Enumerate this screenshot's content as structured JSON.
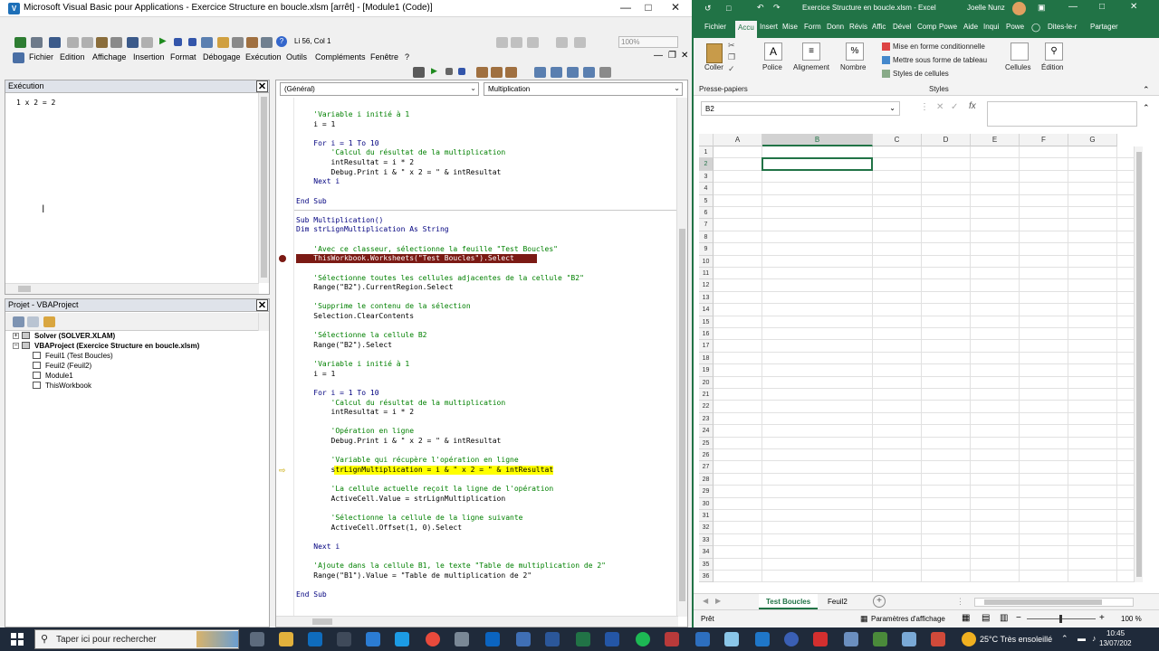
{
  "vba": {
    "title": "Microsoft Visual Basic pour Applications - Exercice Structure en boucle.xlsm [arrêt] - [Module1 (Code)]",
    "position": "Li 56, Col 1",
    "zoom": "100%",
    "menu": [
      "Fichier",
      "Edition",
      "Affichage",
      "Insertion",
      "Format",
      "Débogage",
      "Exécution",
      "Outils",
      "Compléments",
      "Fenêtre",
      "?"
    ],
    "immediate": {
      "title": "Exécution",
      "output": "1 x 2 = 2"
    },
    "project": {
      "title": "Projet - VBAProject",
      "tree": [
        {
          "label": "Solver (SOLVER.XLAM)",
          "bold": true,
          "level": 0
        },
        {
          "label": "VBAProject (Exercice Structure en boucle.xlsm)",
          "bold": true,
          "level": 0
        },
        {
          "label": "Feuil1 (Test Boucles)",
          "bold": false,
          "level": 1
        },
        {
          "label": "Feuil2 (Feuil2)",
          "bold": false,
          "level": 1
        },
        {
          "label": "Module1",
          "bold": false,
          "level": 1
        },
        {
          "label": "ThisWorkbook",
          "bold": false,
          "level": 1
        }
      ]
    },
    "code": {
      "object_combo": "(Général)",
      "proc_combo": "Multiplication",
      "lines": [
        {
          "t": "    'Variable i initié à 1",
          "c": "cm"
        },
        {
          "t": "    i = 1",
          "c": ""
        },
        {
          "t": "",
          "c": ""
        },
        {
          "t": "    For i = 1 To 10",
          "c": "kw"
        },
        {
          "t": "        'Calcul du résultat de la multiplication",
          "c": "cm"
        },
        {
          "t": "        intResultat = i * 2",
          "c": ""
        },
        {
          "t": "        Debug.Print i & \" x 2 = \" & intResultat",
          "c": ""
        },
        {
          "t": "    Next i",
          "c": "kw"
        },
        {
          "t": "",
          "c": ""
        },
        {
          "t": "End Sub",
          "c": "kw"
        },
        {
          "t": "",
          "c": "sep"
        },
        {
          "t": "Sub Multiplication()",
          "c": "kw"
        },
        {
          "t": "Dim strLignMultiplication As String",
          "c": "kw"
        },
        {
          "t": "",
          "c": ""
        },
        {
          "t": "    'Avec ce classeur, sélectionne la feuille \"Test Boucles\"",
          "c": "cm"
        },
        {
          "t": "    ThisWorkbook.Worksheets(\"Test Boucles\").Select",
          "c": "bp"
        },
        {
          "t": "",
          "c": ""
        },
        {
          "t": "    'Sélectionne toutes les cellules adjacentes de la cellule \"B2\"",
          "c": "cm"
        },
        {
          "t": "    Range(\"B2\").CurrentRegion.Select",
          "c": ""
        },
        {
          "t": "",
          "c": ""
        },
        {
          "t": "    'Supprime le contenu de la sélection",
          "c": "cm"
        },
        {
          "t": "    Selection.ClearContents",
          "c": ""
        },
        {
          "t": "",
          "c": ""
        },
        {
          "t": "    'Sélectionne la cellule B2",
          "c": "cm"
        },
        {
          "t": "    Range(\"B2\").Select",
          "c": ""
        },
        {
          "t": "",
          "c": ""
        },
        {
          "t": "    'Variable i initié à 1",
          "c": "cm"
        },
        {
          "t": "    i = 1",
          "c": ""
        },
        {
          "t": "",
          "c": ""
        },
        {
          "t": "    For i = 1 To 10",
          "c": "kw"
        },
        {
          "t": "        'Calcul du résultat de la multiplication",
          "c": "cm"
        },
        {
          "t": "        intResultat = i * 2",
          "c": ""
        },
        {
          "t": "",
          "c": ""
        },
        {
          "t": "        'Opération en ligne",
          "c": "cm"
        },
        {
          "t": "        Debug.Print i & \" x 2 = \" & intResultat",
          "c": ""
        },
        {
          "t": "",
          "c": ""
        },
        {
          "t": "        'Variable qui récupère l'opération en ligne",
          "c": "cm"
        },
        {
          "t": "        strLignMultiplication = i & \" x 2 = \" & intResultat",
          "c": "exec"
        },
        {
          "t": "",
          "c": ""
        },
        {
          "t": "        'La cellule actuelle reçoit la ligne de l'opération",
          "c": "cm"
        },
        {
          "t": "        ActiveCell.Value = strLignMultiplication",
          "c": ""
        },
        {
          "t": "",
          "c": ""
        },
        {
          "t": "        'Sélectionne la cellule de la ligne suivante",
          "c": "cm"
        },
        {
          "t": "        ActiveCell.Offset(1, 0).Select",
          "c": ""
        },
        {
          "t": "",
          "c": ""
        },
        {
          "t": "    Next i",
          "c": "kw"
        },
        {
          "t": "",
          "c": ""
        },
        {
          "t": "    'Ajoute dans la cellule B1, le texte \"Table de multiplication de 2\"",
          "c": "cm"
        },
        {
          "t": "    Range(\"B1\").Value = \"Table de multiplication de 2\"",
          "c": ""
        },
        {
          "t": "",
          "c": ""
        },
        {
          "t": "End Sub",
          "c": "kw"
        }
      ]
    }
  },
  "excel": {
    "title": "Exercice Structure en boucle.xlsm - Excel",
    "user": "Joelle Nunz",
    "tabs": [
      "Fichier",
      "Accu",
      "Insert",
      "Mise",
      "Form",
      "Donn",
      "Révis",
      "Affic",
      "Dével",
      "Comp",
      "Powe",
      "Aide",
      "Inqui",
      "Powe",
      "Dites-le-r",
      "Partager"
    ],
    "active_tab": "Accu",
    "ribbon": {
      "coller": "Coller",
      "presse_papiers": "Presse-papiers",
      "police": "Police",
      "alignement": "Alignement",
      "nombre": "Nombre",
      "mise_en_forme": "Mise en forme conditionnelle",
      "mettre_tableau": "Mettre sous forme de tableau",
      "styles_cellules": "Styles de cellules",
      "styles": "Styles",
      "cellules": "Cellules",
      "edition": "Édition"
    },
    "name_box": "B2",
    "columns": [
      "A",
      "B",
      "C",
      "D",
      "E",
      "F",
      "G"
    ],
    "selected_column": "B",
    "selected_row": 2,
    "row_count": 36,
    "sheets": [
      "Test Boucles",
      "Feuil2"
    ],
    "active_sheet": "Test Boucles",
    "status": {
      "ready": "Prêt",
      "display_settings": "Paramètres d'affichage",
      "zoom": "100 %"
    }
  },
  "taskbar": {
    "search_placeholder": "Taper ici pour rechercher",
    "weather": "25°C Très ensoleillé",
    "time": "10:45",
    "date": "13/07/202"
  },
  "colors": {
    "excel_green": "#217346",
    "breakpoint": "#7b1a14",
    "exec_highlight": "#ffff00",
    "comment": "#008000",
    "keyword": "#00007f"
  }
}
